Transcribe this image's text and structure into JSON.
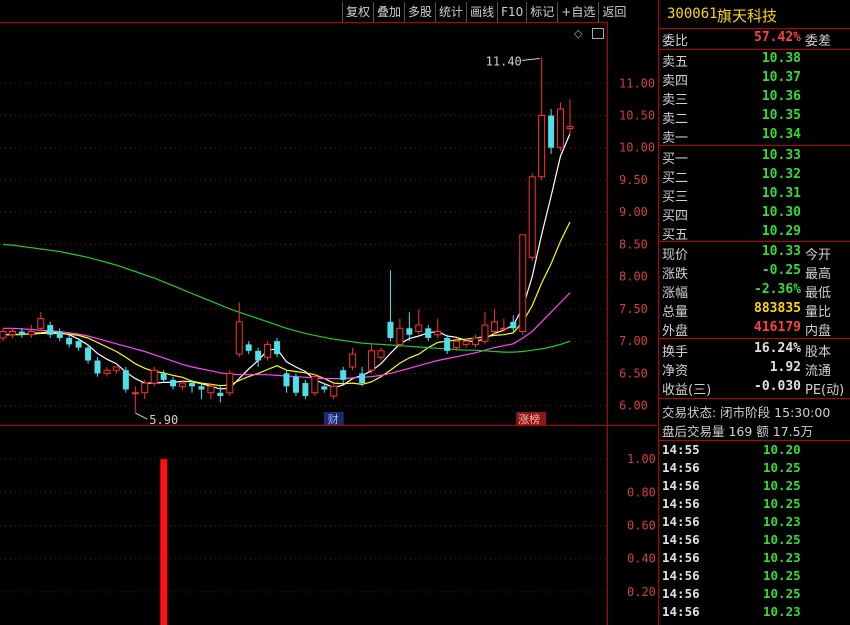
{
  "toolbar": [
    "复权",
    "叠加",
    "多股",
    "统计",
    "画线",
    "F10",
    "标记",
    "+自选",
    "返回"
  ],
  "chart": {
    "price_axis": [
      "11.00",
      "10.50",
      "10.00",
      "9.50",
      "9.00",
      "8.50",
      "8.00",
      "7.50",
      "7.00",
      "6.50",
      "6.00"
    ],
    "max_label": "11.40",
    "min_label": "5.90",
    "event_labels": [
      "财",
      "涨榜"
    ],
    "vol_axis": [
      "1.00",
      "0.80",
      "0.60",
      "0.40",
      "0.20"
    ]
  },
  "chart_data": {
    "type": "candlestick",
    "ylim": [
      5.7,
      11.95
    ],
    "candles": [
      {
        "o": 7.05,
        "c": 7.15,
        "h": 7.2,
        "l": 7.0
      },
      {
        "o": 7.1,
        "c": 7.15,
        "h": 7.2,
        "l": 7.05
      },
      {
        "o": 7.15,
        "c": 7.1,
        "h": 7.2,
        "l": 7.05
      },
      {
        "o": 7.1,
        "c": 7.15,
        "h": 7.25,
        "l": 7.05
      },
      {
        "o": 7.2,
        "c": 7.35,
        "h": 7.45,
        "l": 7.15
      },
      {
        "o": 7.25,
        "c": 7.1,
        "h": 7.3,
        "l": 7.05
      },
      {
        "o": 7.15,
        "c": 7.05,
        "h": 7.2,
        "l": 7.0
      },
      {
        "o": 7.05,
        "c": 6.95,
        "h": 7.1,
        "l": 6.9
      },
      {
        "o": 7.0,
        "c": 6.9,
        "h": 7.05,
        "l": 6.85
      },
      {
        "o": 6.9,
        "c": 6.7,
        "h": 6.95,
        "l": 6.65
      },
      {
        "o": 6.7,
        "c": 6.5,
        "h": 6.75,
        "l": 6.45
      },
      {
        "o": 6.5,
        "c": 6.55,
        "h": 6.6,
        "l": 6.45
      },
      {
        "o": 6.55,
        "c": 6.6,
        "h": 6.6,
        "l": 6.5
      },
      {
        "o": 6.55,
        "c": 6.25,
        "h": 6.6,
        "l": 6.2
      },
      {
        "o": 6.2,
        "c": 6.2,
        "h": 6.3,
        "l": 5.9
      },
      {
        "o": 6.2,
        "c": 6.35,
        "h": 6.4,
        "l": 6.1
      },
      {
        "o": 6.35,
        "c": 6.55,
        "h": 6.6,
        "l": 6.3
      },
      {
        "o": 6.5,
        "c": 6.4,
        "h": 6.55,
        "l": 6.35
      },
      {
        "o": 6.4,
        "c": 6.3,
        "h": 6.45,
        "l": 6.25
      },
      {
        "o": 6.3,
        "c": 6.35,
        "h": 6.4,
        "l": 6.25
      },
      {
        "o": 6.35,
        "c": 6.3,
        "h": 6.4,
        "l": 6.2
      },
      {
        "o": 6.3,
        "c": 6.25,
        "h": 6.35,
        "l": 6.1
      },
      {
        "o": 6.2,
        "c": 6.3,
        "h": 6.35,
        "l": 6.1
      },
      {
        "o": 6.2,
        "c": 6.15,
        "h": 6.3,
        "l": 6.05
      },
      {
        "o": 6.2,
        "c": 6.5,
        "h": 6.55,
        "l": 6.15
      },
      {
        "o": 6.8,
        "c": 7.3,
        "h": 7.6,
        "l": 6.75
      },
      {
        "o": 6.95,
        "c": 6.85,
        "h": 7.0,
        "l": 6.8
      },
      {
        "o": 6.85,
        "c": 6.7,
        "h": 6.9,
        "l": 6.6
      },
      {
        "o": 6.75,
        "c": 6.95,
        "h": 7.0,
        "l": 6.7
      },
      {
        "o": 7.0,
        "c": 6.8,
        "h": 7.05,
        "l": 6.75
      },
      {
        "o": 6.5,
        "c": 6.3,
        "h": 6.55,
        "l": 6.2
      },
      {
        "o": 6.45,
        "c": 6.2,
        "h": 6.5,
        "l": 6.15
      },
      {
        "o": 6.35,
        "c": 6.15,
        "h": 6.4,
        "l": 6.1
      },
      {
        "o": 6.2,
        "c": 6.45,
        "h": 6.5,
        "l": 6.15
      },
      {
        "o": 6.3,
        "c": 6.25,
        "h": 6.35,
        "l": 6.2
      },
      {
        "o": 6.15,
        "c": 6.3,
        "h": 6.35,
        "l": 6.1
      },
      {
        "o": 6.55,
        "c": 6.4,
        "h": 6.6,
        "l": 6.35
      },
      {
        "o": 6.6,
        "c": 6.8,
        "h": 6.9,
        "l": 6.55
      },
      {
        "o": 6.5,
        "c": 6.35,
        "h": 6.6,
        "l": 6.3
      },
      {
        "o": 6.55,
        "c": 6.85,
        "h": 6.95,
        "l": 6.5
      },
      {
        "o": 6.75,
        "c": 6.85,
        "h": 6.9,
        "l": 6.7
      },
      {
        "o": 7.3,
        "c": 7.05,
        "h": 8.1,
        "l": 7.0
      },
      {
        "o": 6.95,
        "c": 7.2,
        "h": 7.35,
        "l": 6.9
      },
      {
        "o": 7.2,
        "c": 7.1,
        "h": 7.45,
        "l": 7.0
      },
      {
        "o": 7.15,
        "c": 7.25,
        "h": 7.5,
        "l": 7.1
      },
      {
        "o": 7.2,
        "c": 7.05,
        "h": 7.25,
        "l": 7.0
      },
      {
        "o": 7.1,
        "c": 7.15,
        "h": 7.35,
        "l": 7.05
      },
      {
        "o": 7.05,
        "c": 6.85,
        "h": 7.1,
        "l": 6.8
      },
      {
        "o": 6.9,
        "c": 7.0,
        "h": 7.05,
        "l": 6.85
      },
      {
        "o": 6.95,
        "c": 7.0,
        "h": 7.05,
        "l": 6.9
      },
      {
        "o": 6.95,
        "c": 7.05,
        "h": 7.1,
        "l": 6.9
      },
      {
        "o": 7.0,
        "c": 7.25,
        "h": 7.45,
        "l": 6.95
      },
      {
        "o": 7.15,
        "c": 7.3,
        "h": 7.5,
        "l": 7.1
      },
      {
        "o": 7.2,
        "c": 7.2,
        "h": 7.35,
        "l": 7.15
      },
      {
        "o": 7.3,
        "c": 7.2,
        "h": 7.4,
        "l": 7.15
      },
      {
        "o": 7.15,
        "c": 8.65,
        "h": 8.65,
        "l": 7.1
      },
      {
        "o": 8.3,
        "c": 9.55,
        "h": 9.6,
        "l": 8.25
      },
      {
        "o": 9.55,
        "c": 10.5,
        "h": 11.4,
        "l": 9.5
      },
      {
        "o": 10.5,
        "c": 10.0,
        "h": 10.6,
        "l": 9.9
      },
      {
        "o": 10.0,
        "c": 10.6,
        "h": 10.7,
        "l": 9.95
      },
      {
        "o": 10.3,
        "c": 10.33,
        "h": 10.75,
        "l": 10.2
      }
    ],
    "ma": [
      {
        "name": "MA5",
        "color": "#ffffff",
        "values": [
          7.1,
          7.1,
          7.1,
          7.12,
          7.13,
          7.15,
          7.13,
          7.1,
          7.03,
          6.94,
          6.81,
          6.72,
          6.65,
          6.52,
          6.42,
          6.35,
          6.35,
          6.36,
          6.36,
          6.38,
          6.37,
          6.34,
          6.3,
          6.26,
          6.27,
          6.42,
          6.57,
          6.7,
          6.86,
          6.88,
          6.68,
          6.6,
          6.53,
          6.4,
          6.34,
          6.28,
          6.32,
          6.42,
          6.47,
          6.54,
          6.65,
          6.81,
          6.96,
          7.04,
          7.08,
          7.13,
          7.15,
          7.08,
          7.06,
          7.01,
          6.99,
          7.04,
          7.12,
          7.17,
          7.25,
          7.52,
          8.0,
          8.65,
          9.25,
          9.87,
          10.22
        ]
      },
      {
        "name": "MA10",
        "color": "#ffff00",
        "values": [
          7.1,
          7.1,
          7.11,
          7.11,
          7.12,
          7.12,
          7.12,
          7.11,
          7.09,
          7.05,
          6.98,
          6.91,
          6.84,
          6.75,
          6.65,
          6.58,
          6.53,
          6.51,
          6.47,
          6.44,
          6.38,
          6.35,
          6.33,
          6.31,
          6.32,
          6.39,
          6.45,
          6.5,
          6.56,
          6.62,
          6.55,
          6.53,
          6.51,
          6.48,
          6.42,
          6.35,
          6.34,
          6.35,
          6.33,
          6.37,
          6.45,
          6.55,
          6.66,
          6.74,
          6.8,
          6.9,
          6.98,
          7.0,
          7.02,
          7.03,
          7.05,
          7.07,
          7.09,
          7.1,
          7.13,
          7.3,
          7.55,
          7.9,
          8.2,
          8.55,
          8.85
        ]
      },
      {
        "name": "MA20",
        "color": "#ff44ff",
        "values": [
          7.2,
          7.2,
          7.19,
          7.18,
          7.17,
          7.16,
          7.15,
          7.13,
          7.11,
          7.08,
          7.04,
          7.0,
          6.96,
          6.92,
          6.88,
          6.84,
          6.79,
          6.74,
          6.69,
          6.64,
          6.6,
          6.57,
          6.54,
          6.51,
          6.49,
          6.48,
          6.48,
          6.48,
          6.48,
          6.47,
          6.46,
          6.45,
          6.44,
          6.43,
          6.42,
          6.42,
          6.42,
          6.43,
          6.44,
          6.45,
          6.47,
          6.5,
          6.54,
          6.58,
          6.62,
          6.66,
          6.7,
          6.73,
          6.76,
          6.79,
          6.82,
          6.86,
          6.9,
          6.93,
          6.96,
          7.05,
          7.15,
          7.3,
          7.45,
          7.6,
          7.75
        ]
      },
      {
        "name": "MA60",
        "color": "#22cc22",
        "values": [
          8.5,
          8.49,
          8.47,
          8.45,
          8.43,
          8.41,
          8.39,
          8.36,
          8.33,
          8.3,
          8.26,
          8.22,
          8.18,
          8.13,
          8.08,
          8.03,
          7.98,
          7.92,
          7.86,
          7.8,
          7.74,
          7.68,
          7.62,
          7.56,
          7.5,
          7.45,
          7.4,
          7.35,
          7.3,
          7.25,
          7.2,
          7.16,
          7.12,
          7.09,
          7.06,
          7.03,
          7.01,
          6.99,
          6.97,
          6.96,
          6.95,
          6.94,
          6.93,
          6.92,
          6.91,
          6.9,
          6.89,
          6.88,
          6.87,
          6.86,
          6.86,
          6.85,
          6.84,
          6.83,
          6.83,
          6.84,
          6.86,
          6.88,
          6.91,
          6.95,
          7.0
        ]
      }
    ],
    "volume": {
      "ylim": [
        0,
        1.2
      ],
      "bar_index": 14,
      "value": 1.0
    }
  },
  "quote": {
    "code": "300061",
    "name": "旗天科技",
    "weibi_label": "委比",
    "weibi_value": "57.42%",
    "weicha_label": "委差",
    "sell": [
      {
        "label": "卖五",
        "price": "10.38"
      },
      {
        "label": "卖四",
        "price": "10.37"
      },
      {
        "label": "卖三",
        "price": "10.36"
      },
      {
        "label": "卖二",
        "price": "10.35"
      },
      {
        "label": "卖一",
        "price": "10.34"
      }
    ],
    "buy": [
      {
        "label": "买一",
        "price": "10.33"
      },
      {
        "label": "买二",
        "price": "10.32"
      },
      {
        "label": "买三",
        "price": "10.31"
      },
      {
        "label": "买四",
        "price": "10.30"
      },
      {
        "label": "买五",
        "price": "10.29"
      }
    ],
    "stats": [
      {
        "label": "现价",
        "value": "10.33",
        "right": "今开",
        "color": "green"
      },
      {
        "label": "涨跌",
        "value": "-0.25",
        "right": "最高",
        "color": "green"
      },
      {
        "label": "涨幅",
        "value": "-2.36%",
        "right": "最低",
        "color": "green"
      },
      {
        "label": "总量",
        "value": "883835",
        "right": "量比",
        "color": "yellow"
      },
      {
        "label": "外盘",
        "value": "416179",
        "right": "内盘",
        "color": "red"
      }
    ],
    "stats2": [
      {
        "label": "换手",
        "value": "16.24%",
        "right": "股本"
      },
      {
        "label": "净资",
        "value": "1.92",
        "right": "流通"
      },
      {
        "label": "收益(三)",
        "value": "-0.030",
        "right": "PE(动)"
      }
    ],
    "status": "交易状态: 闭市阶段 15:30:00",
    "after_hours": "盘后交易量 169 额 17.5万",
    "ticks": [
      {
        "time": "14:55",
        "price": "10.20"
      },
      {
        "time": "14:56",
        "price": "10.25"
      },
      {
        "time": "14:56",
        "price": "10.25"
      },
      {
        "time": "14:56",
        "price": "10.25"
      },
      {
        "time": "14:56",
        "price": "10.23"
      },
      {
        "time": "14:56",
        "price": "10.25"
      },
      {
        "time": "14:56",
        "price": "10.23"
      },
      {
        "time": "14:56",
        "price": "10.25"
      },
      {
        "time": "14:56",
        "price": "10.25"
      },
      {
        "time": "14:56",
        "price": "10.23"
      }
    ]
  }
}
